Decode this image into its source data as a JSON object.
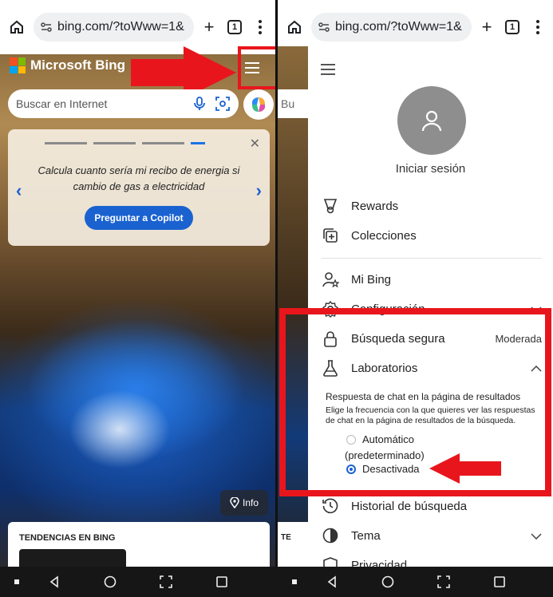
{
  "browser": {
    "url": "bing.com/?toWww=1&",
    "tab_count": "1"
  },
  "bing": {
    "brand": "Microsoft Bing",
    "search_placeholder": "Buscar en Internet",
    "card_text": "Calcula cuanto sería mi recibo de energia si cambio de gas a electricidad",
    "card_cta": "Preguntar a Copilot",
    "info_label": "Info",
    "trending_title": "TENDENCIAS EN BING",
    "partial_search": "Bu",
    "partial_trending": "TE"
  },
  "menu": {
    "signin": "Iniciar sesión",
    "items": {
      "rewards": "Rewards",
      "collections": "Colecciones",
      "mybing": "Mi Bing",
      "settings": "Configuración",
      "safesearch": "Búsqueda segura",
      "safesearch_value": "Moderada",
      "labs": "Laboratorios",
      "history": "Historial de búsqueda",
      "theme": "Tema",
      "privacy": "Privacidad"
    },
    "labs": {
      "heading": "Respuesta de chat en la página de resultados",
      "description": "Elige la frecuencia con la que quieres ver las respuestas de chat en la página de resultados de la búsqueda.",
      "option_auto": "Automático",
      "option_auto_note": "(predeterminado)",
      "option_off": "Desactivada",
      "selected": "Desactivada"
    }
  },
  "colors": {
    "annotation_red": "#e8161c",
    "bing_blue": "#1a62d0"
  }
}
